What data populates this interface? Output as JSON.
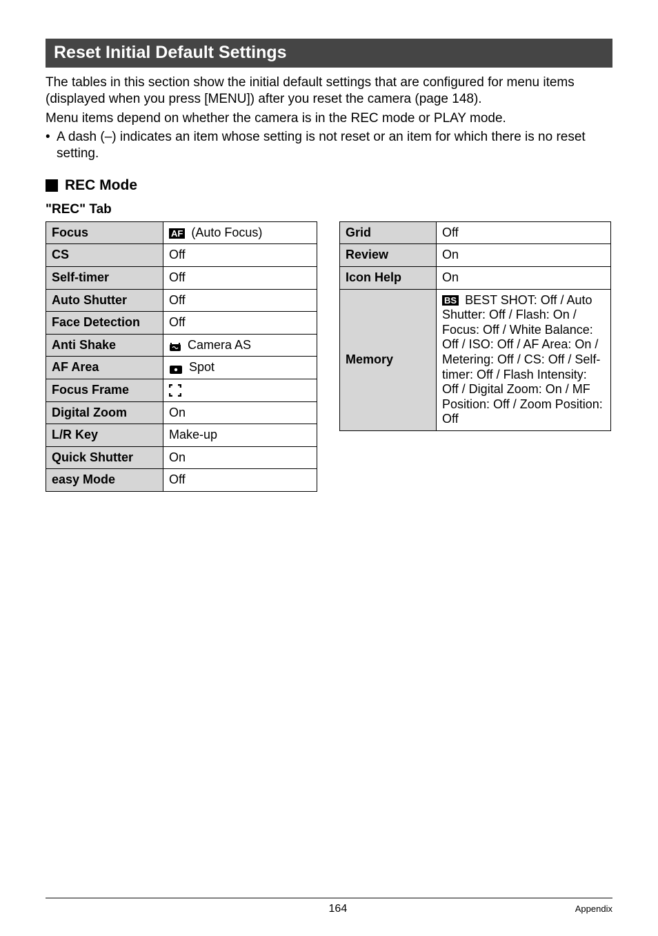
{
  "headingBar": "Reset Initial Default Settings",
  "intro1": "The tables in this section show the initial default settings that are configured for menu items (displayed when you press [MENU]) after you reset the camera (page 148).",
  "intro2": "Menu items depend on whether the camera is in the REC mode or PLAY mode.",
  "bullet1": "A dash (–) indicates an item whose setting is not reset or an item for which there is no reset setting.",
  "recModeHeading": "REC Mode",
  "recTabName": "\"REC\" Tab",
  "leftTable": {
    "rows": [
      {
        "label": "Focus",
        "icon": "af",
        "value": " (Auto Focus)"
      },
      {
        "label": "CS",
        "value": "Off"
      },
      {
        "label": "Self-timer",
        "value": "Off"
      },
      {
        "label": "Auto Shutter",
        "value": "Off"
      },
      {
        "label": "Face Detection",
        "value": "Off"
      },
      {
        "label": "Anti Shake",
        "icon": "antishake",
        "value": " Camera AS"
      },
      {
        "label": "AF Area",
        "icon": "spot",
        "value": " Spot"
      },
      {
        "label": "Focus Frame",
        "icon": "frame",
        "value": ""
      },
      {
        "label": "Digital Zoom",
        "value": "On"
      },
      {
        "label": "L/R Key",
        "value": "Make-up"
      },
      {
        "label": "Quick Shutter",
        "value": "On"
      },
      {
        "label": "easy Mode",
        "value": "Off"
      }
    ]
  },
  "rightTable": {
    "row0": {
      "label": "Grid",
      "value": "Off"
    },
    "row1": {
      "label": "Review",
      "value": "On"
    },
    "row2": {
      "label": "Icon Help",
      "value": "On"
    },
    "memory": {
      "label": "Memory",
      "bsText": " BEST SHOT: Off / Auto Shutter: Off / Flash: On / Focus: Off / White Balance: Off / ISO: Off / AF Area: On / Metering: Off / CS: Off / Self-timer: Off / Flash Intensity: Off / Digital Zoom: On / MF Position: Off / Zoom Position: Off"
    }
  },
  "footer": {
    "pageNumber": "164",
    "appendix": "Appendix"
  },
  "iconLabels": {
    "af": "AF",
    "bs": "BS"
  }
}
